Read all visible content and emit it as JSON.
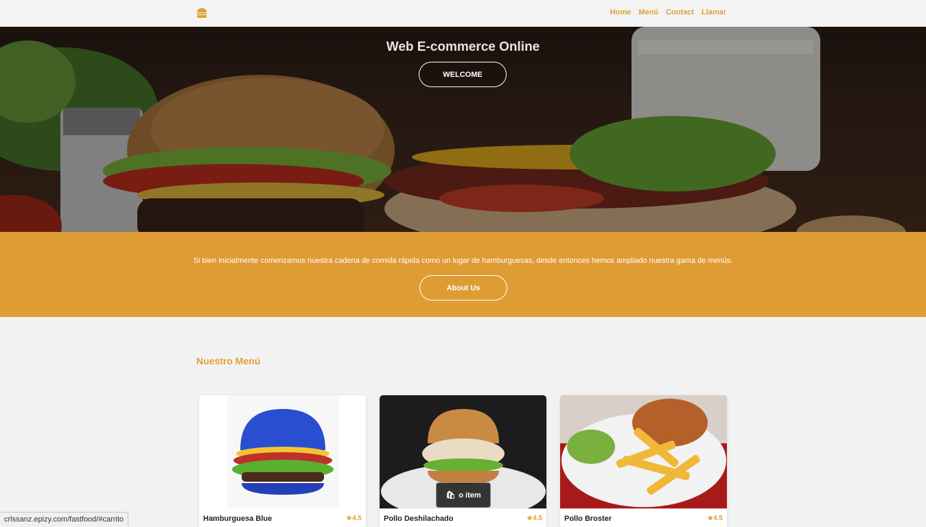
{
  "header": {
    "logo_icon": "burger-icon",
    "nav": [
      "Home",
      "Menú",
      "Contact",
      "Llamar"
    ],
    "accent": "#e0a033"
  },
  "hero": {
    "title": "Web E-commerce Online",
    "button": "WELCOME"
  },
  "about": {
    "text": "Si bien inicialmente comenzamos nuestra cadena de comida rápida como un lugar de hamburguesas, desde entonces hemos ampliado nuestra gama de menús.",
    "button": "About Us",
    "background": "#df9c34"
  },
  "menu": {
    "title": "Nuestro Menú",
    "items": [
      {
        "name": "Hamburguesa Blue",
        "rating": "4.5"
      },
      {
        "name": "Pollo Deshilachado",
        "rating": "4.5",
        "cart_label": "o item"
      },
      {
        "name": "Pollo Broster",
        "rating": "4.5"
      }
    ]
  },
  "status_bar": {
    "url": "crlssanz.epizy.com/fastfood/#carrito"
  }
}
